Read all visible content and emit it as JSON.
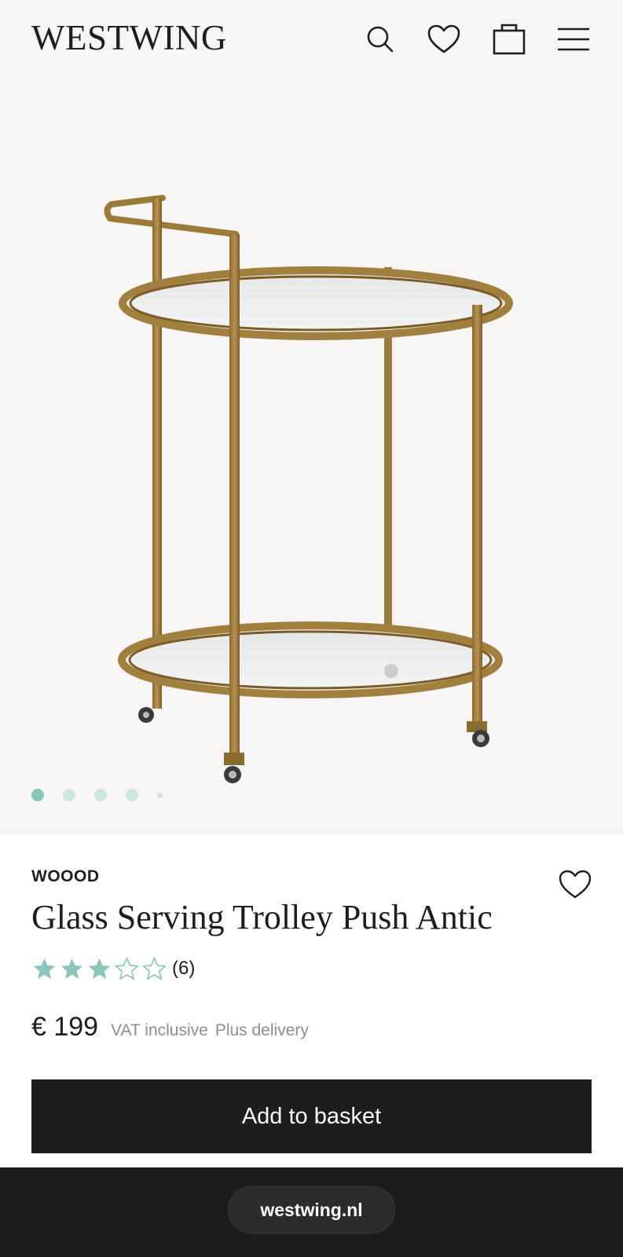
{
  "header": {
    "logo": "WESTWING",
    "icons": [
      "search-icon",
      "heart-icon",
      "bag-icon",
      "menu-icon"
    ]
  },
  "gallery": {
    "image_count": 5,
    "active_index": 0
  },
  "product": {
    "brand": "WOOOD",
    "title": "Glass Serving Trolley Push Antic",
    "rating": 3,
    "rating_max": 5,
    "rating_count": "(6)",
    "price": "€ 199",
    "vat_note": "VAT inclusive",
    "delivery_note": "Plus delivery",
    "add_button": "Add to basket"
  },
  "browser": {
    "url": "westwing.nl"
  },
  "colors": {
    "background": "#f8f6f5",
    "accent_teal": "#8cc5bb",
    "button": "#1d1d1f",
    "muted_text": "#8e8e8e"
  }
}
